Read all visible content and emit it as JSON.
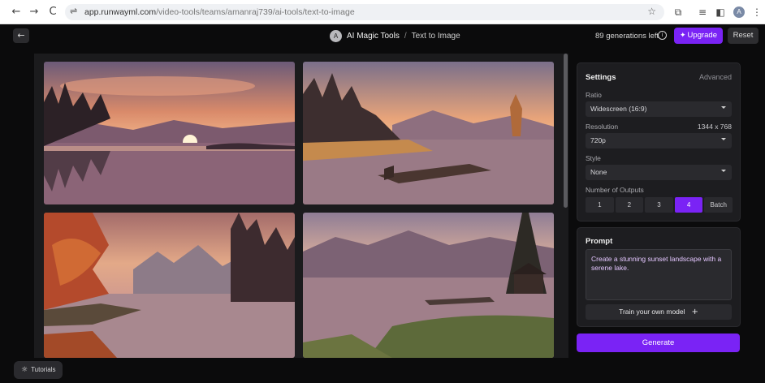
{
  "browser": {
    "back_icon": "←",
    "forward_icon": "→",
    "reload_icon": "C",
    "tune_icon": "⇌",
    "url_host": "app.runwayml.com",
    "url_path": "/video-tools/teams/amanraj739/ai-tools/text-to-image",
    "star_icon": "☆",
    "extension_icons": [
      "⧉",
      "≡",
      "◧"
    ],
    "profile_initial": "A",
    "menu_icon": "⋮"
  },
  "header": {
    "back_icon": "←",
    "tool_avatar": "A",
    "tool_name": "AI Magic Tools",
    "separator": "/",
    "page_name": "Text to Image",
    "generations_left": "89 generations left",
    "info_icon": "i",
    "upgrade_icon": "✦",
    "upgrade_label": "Upgrade",
    "reset_label": "Reset"
  },
  "settings": {
    "title": "Settings",
    "advanced_label": "Advanced",
    "ratio_label": "Ratio",
    "ratio_value": "Widescreen (16:9)",
    "resolution_label": "Resolution",
    "resolution_dims": "1344 x 768",
    "resolution_value": "720p",
    "style_label": "Style",
    "style_value": "None",
    "outputs_label": "Number of Outputs",
    "output_options": [
      "1",
      "2",
      "3",
      "4",
      "Batch"
    ],
    "selected_output": "4"
  },
  "prompt": {
    "title": "Prompt",
    "text": "Create a stunning sunset landscape with a serene lake.",
    "train_label": "Train your own model",
    "train_icon": "+"
  },
  "generate_label": "Generate",
  "tutorials": {
    "icon": "☼",
    "label": "Tutorials"
  },
  "colors": {
    "accent": "#7a23f5",
    "background": "#0b0b0c",
    "panel": "#1d1d20"
  }
}
